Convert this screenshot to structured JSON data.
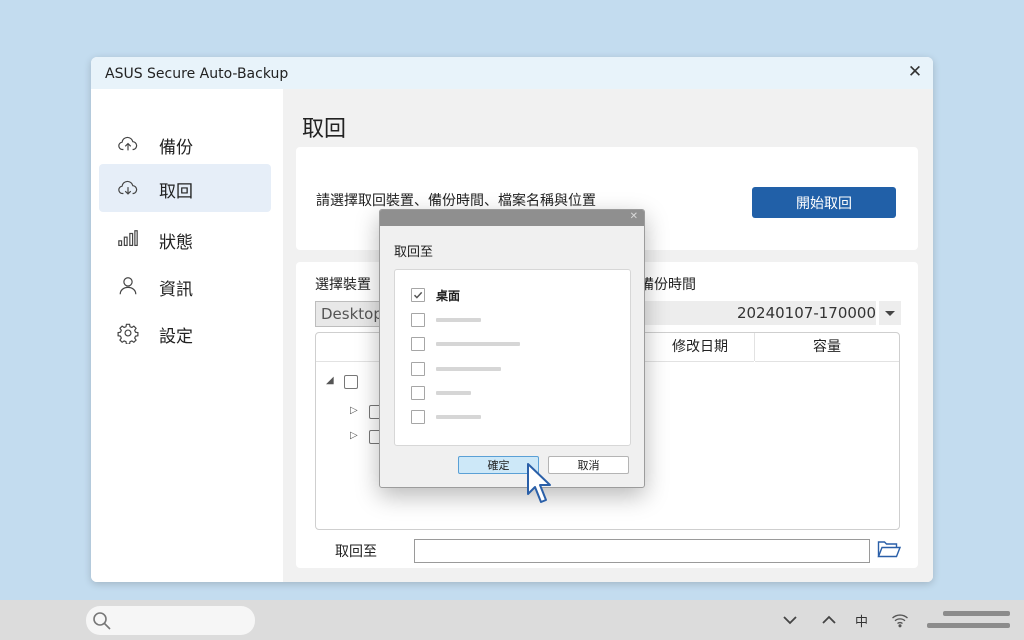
{
  "window": {
    "title": "ASUS Secure Auto-Backup",
    "close_glyph": "✕"
  },
  "sidebar": {
    "items": [
      {
        "label": "備份",
        "icon": "cloud-upload-icon",
        "active": false
      },
      {
        "label": "取回",
        "icon": "cloud-download-icon",
        "active": true
      },
      {
        "label": "狀態",
        "icon": "bar-chart-icon",
        "active": false
      },
      {
        "label": "資訊",
        "icon": "user-icon",
        "active": false
      },
      {
        "label": "設定",
        "icon": "gear-icon",
        "active": false
      }
    ]
  },
  "main": {
    "page_title": "取回",
    "instruction": "請選擇取回裝置、備份時間、檔案名稱與位置",
    "start_button": "開始取回",
    "select_device_label": "選擇裝置",
    "device_value": "Desktop",
    "backup_time_label": "備份時間",
    "backup_time_value": "20240107-170000",
    "columns": [
      "修改日期",
      "容量"
    ],
    "restore_to_label": "取回至",
    "restore_to_value": ""
  },
  "dialog": {
    "label": "取回至",
    "options": [
      {
        "label": "桌面",
        "checked": true
      },
      {
        "label": "",
        "checked": false
      },
      {
        "label": "",
        "checked": false
      },
      {
        "label": "",
        "checked": false
      },
      {
        "label": "",
        "checked": false
      },
      {
        "label": "",
        "checked": false
      }
    ],
    "ok_button": "確定",
    "cancel_button": "取消",
    "close_glyph": "✕"
  },
  "taskbar": {
    "search_placeholder": "",
    "ime_label": "中",
    "colors": {
      "accent": "#2160a8",
      "background": "#c3dcef"
    }
  }
}
